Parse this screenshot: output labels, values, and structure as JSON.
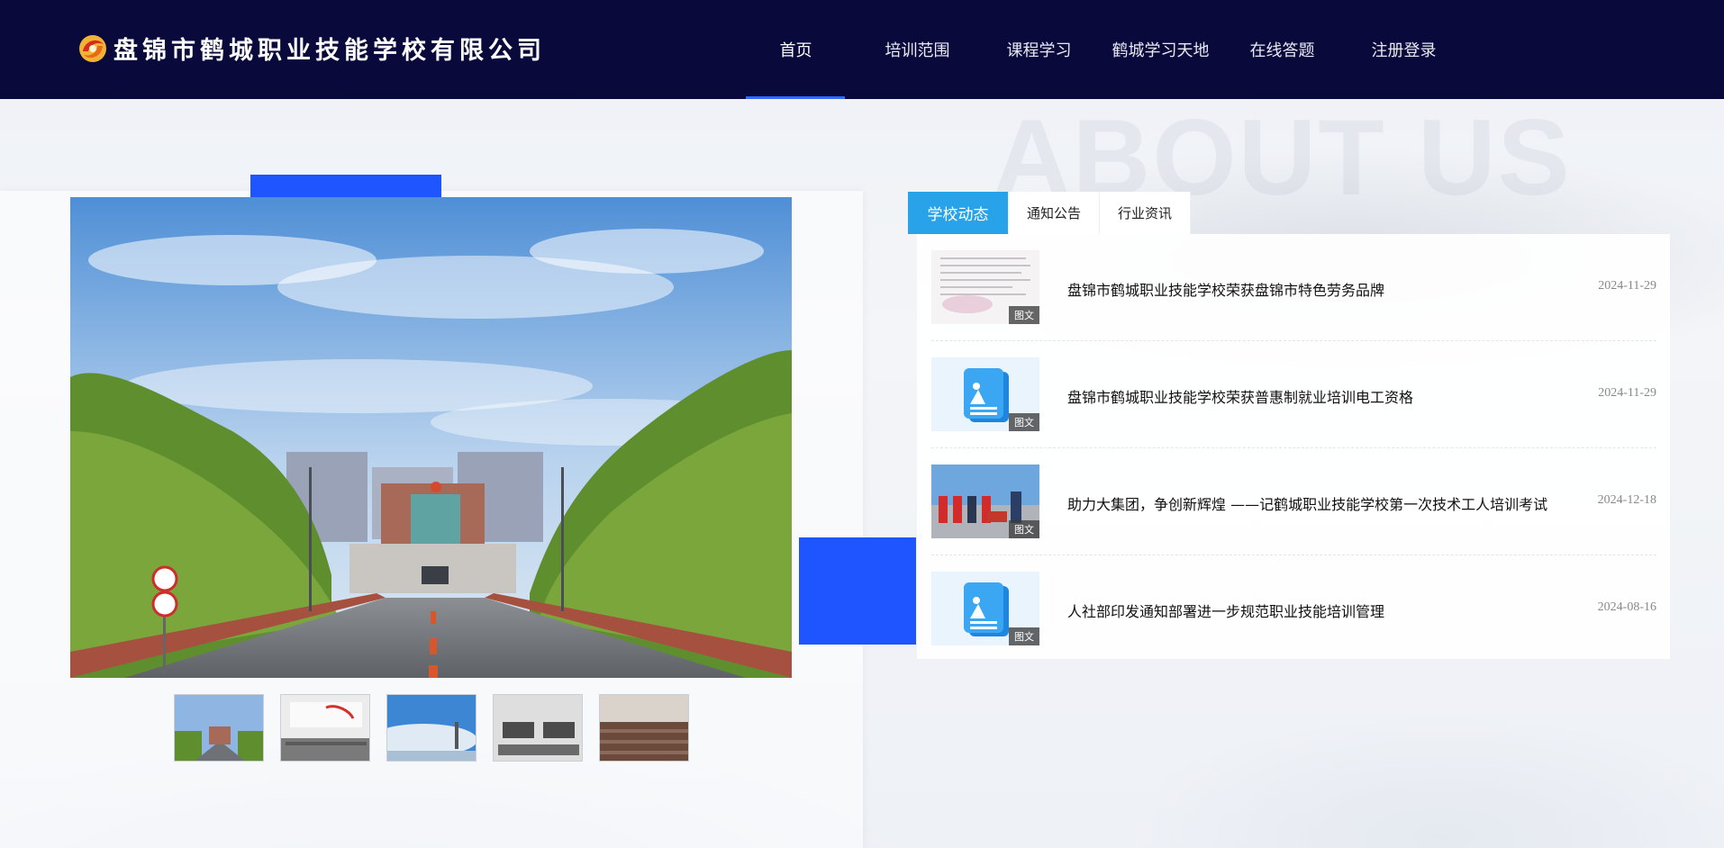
{
  "brand": {
    "name": "盘锦市鹤城职业技能学校有限公司",
    "logo_icon": "swirl-logo-icon",
    "colors": {
      "header_bg": "#090a3b",
      "accent_blue": "#1f55ff",
      "tab_active": "#28a2e8"
    }
  },
  "nav": {
    "items": [
      {
        "label": "首页",
        "active": true
      },
      {
        "label": "培训范围"
      },
      {
        "label": "课程学习"
      },
      {
        "label": "鹤城学习天地"
      },
      {
        "label": "在线答题"
      },
      {
        "label": "注册登录"
      }
    ]
  },
  "watermark": "ABOUT US",
  "gallery": {
    "main_image": "campus-road-photo",
    "thumbnails": [
      "campus-road-photo",
      "classroom-banner-photo",
      "sky-building-photo",
      "computer-lab-photo",
      "lecture-hall-photo"
    ]
  },
  "news": {
    "tabs": [
      {
        "label": "学校动态",
        "active": true
      },
      {
        "label": "通知公告"
      },
      {
        "label": "行业资讯"
      }
    ],
    "items": [
      {
        "title": "盘锦市鹤城职业技能学校荣获盘锦市特色劳务品牌",
        "date": "2024-11-29",
        "badge": "图文",
        "thumb": "document-photo"
      },
      {
        "title": "盘锦市鹤城职业技能学校荣获普惠制就业培训电工资格",
        "date": "2024-11-29",
        "badge": "图文",
        "thumb": "default-doc-icon"
      },
      {
        "title": "助力大集团，争创新辉煌 ——记鹤城职业技能学校第一次技术工人培训考试",
        "date": "2024-12-18",
        "badge": "图文",
        "thumb": "workers-photo"
      },
      {
        "title": "人社部印发通知部署进一步规范职业技能培训管理",
        "date": "2024-08-16",
        "badge": "图文",
        "thumb": "default-doc-icon"
      }
    ]
  }
}
